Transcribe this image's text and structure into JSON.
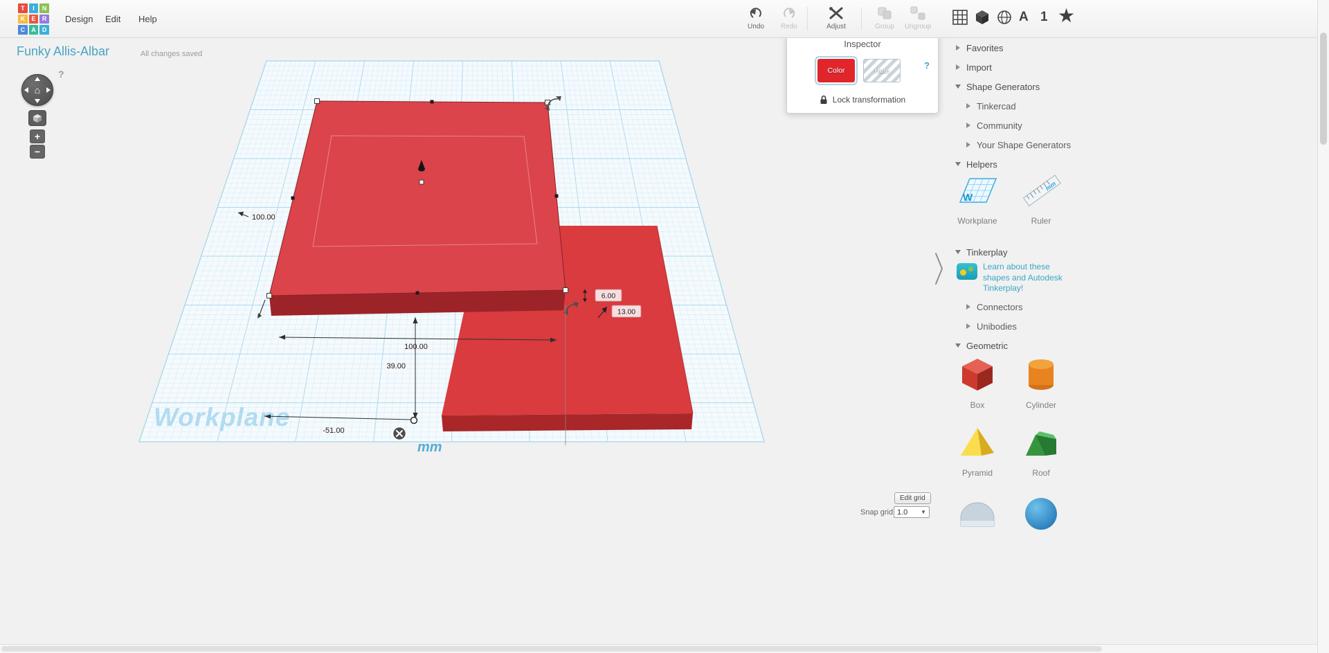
{
  "app": {
    "logo": {
      "letters": [
        "T",
        "I",
        "N",
        "K",
        "E",
        "R",
        "C",
        "A",
        "D"
      ]
    },
    "menu": [
      {
        "label": "Design"
      },
      {
        "label": "Edit"
      },
      {
        "label": "Help"
      }
    ],
    "toolbar": [
      {
        "label": "Undo"
      },
      {
        "label": "Redo"
      },
      {
        "label": "Adjust"
      },
      {
        "label": "Group"
      },
      {
        "label": "Ungroup"
      }
    ],
    "top_icons": {
      "letter_a": "A",
      "number_one": "1"
    }
  },
  "header": {
    "title": "Funky Allis-Albar",
    "status": "All changes saved",
    "help": "?"
  },
  "inspector": {
    "title": "Inspector",
    "color": "Color",
    "hole": "Hole",
    "help": "?",
    "lock": "Lock transformation"
  },
  "viewport": {
    "watermark": "Workplane",
    "unit": "mm",
    "dims": {
      "left_width": "100.00",
      "bottom_width": "100.00",
      "depth": "39.00",
      "offset_x": "-51.00",
      "height_a": "6.00",
      "height_b": "13.00"
    }
  },
  "grid_controls": {
    "edit_button": "Edit grid",
    "snap_label": "Snap grid",
    "snap_value": "1.0"
  },
  "panel": {
    "sections": [
      {
        "label": "Favorites",
        "state": "collapsed"
      },
      {
        "label": "Import",
        "state": "collapsed"
      },
      {
        "label": "Shape Generators",
        "state": "expanded"
      },
      {
        "label": "Tinkercad",
        "state": "collapsed"
      },
      {
        "label": "Community",
        "state": "collapsed"
      },
      {
        "label": "Your Shape Generators",
        "state": "collapsed"
      },
      {
        "label": "Helpers",
        "state": "expanded"
      },
      {
        "label": "Tinkerplay",
        "state": "expanded"
      },
      {
        "label": "Connectors",
        "state": "collapsed"
      },
      {
        "label": "Unibodies",
        "state": "collapsed"
      },
      {
        "label": "Geometric",
        "state": "expanded"
      }
    ],
    "helpers": [
      {
        "label": "Workplane",
        "badge": "W"
      },
      {
        "label": "Ruler",
        "badge": "mm"
      }
    ],
    "tinkerplay_link": "Learn about these shapes and Autodesk Tinkerplay!",
    "geometric": [
      {
        "label": "Box"
      },
      {
        "label": "Cylinder"
      },
      {
        "label": "Pyramid"
      },
      {
        "label": "Roof"
      }
    ]
  },
  "colors": {
    "shape_red": "#d93a3e",
    "chip_red": "#e0262b",
    "workplane_blue": "#2aabe2",
    "link_blue": "#3aa6c4",
    "title_teal": "#4aa3c2"
  }
}
